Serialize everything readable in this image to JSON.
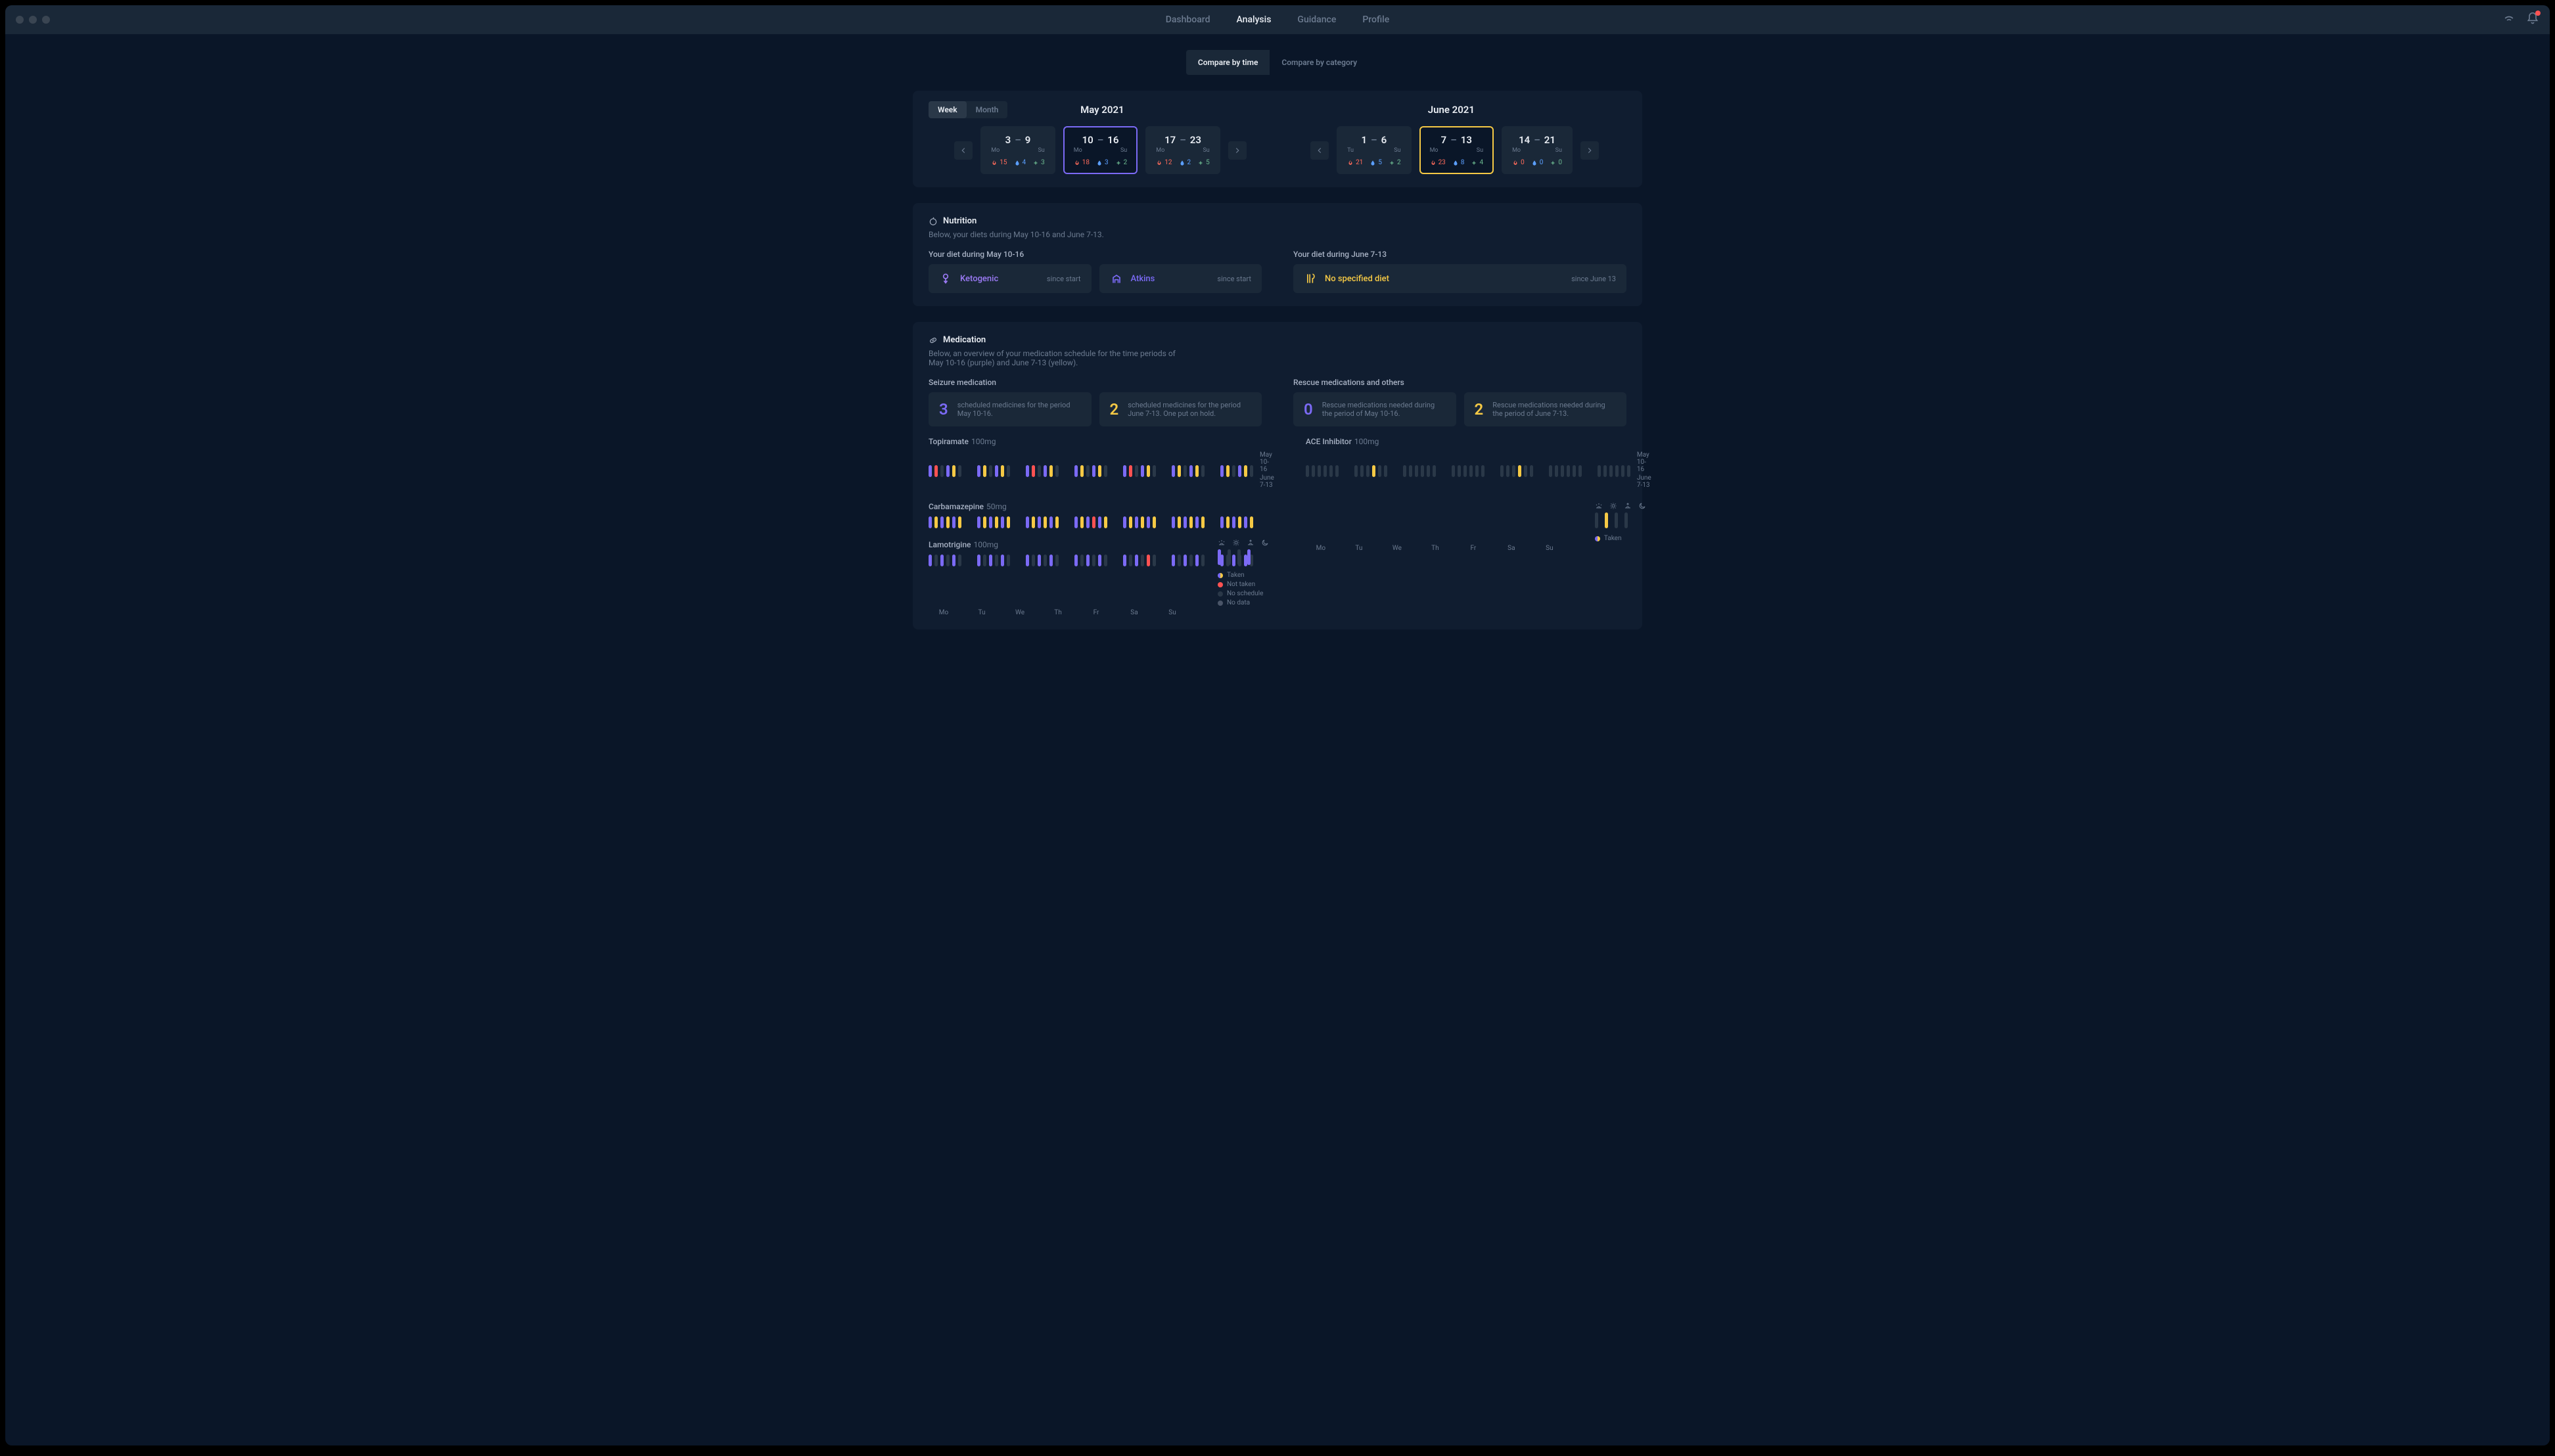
{
  "nav": {
    "tabs": [
      "Dashboard",
      "Analysis",
      "Guidance",
      "Profile"
    ],
    "active_index": 1
  },
  "compare": {
    "by_time": "Compare by time",
    "by_category": "Compare by category",
    "active": "by_time"
  },
  "range_seg": {
    "week": "Week",
    "month": "Month",
    "active": "week"
  },
  "periods": {
    "left": {
      "label": "May 2021",
      "weeks": [
        {
          "d1": "3",
          "d2": "9",
          "day1": "Mo",
          "day2": "Su",
          "fire": 15,
          "drop": 4,
          "med": 3
        },
        {
          "d1": "10",
          "d2": "16",
          "day1": "Mo",
          "day2": "Su",
          "fire": 18,
          "drop": 3,
          "med": 2,
          "selected": "purple"
        },
        {
          "d1": "17",
          "d2": "23",
          "day1": "Mo",
          "day2": "Su",
          "fire": 12,
          "drop": 2,
          "med": 5
        }
      ]
    },
    "right": {
      "label": "June 2021",
      "weeks": [
        {
          "d1": "1",
          "d2": "6",
          "day1": "Tu",
          "day2": "Su",
          "fire": 21,
          "drop": 5,
          "med": 2
        },
        {
          "d1": "7",
          "d2": "13",
          "day1": "Mo",
          "day2": "Su",
          "fire": 23,
          "drop": 8,
          "med": 4,
          "selected": "yellow"
        },
        {
          "d1": "14",
          "d2": "21",
          "day1": "Mo",
          "day2": "Su",
          "fire": 0,
          "drop": 0,
          "med": 0
        }
      ]
    }
  },
  "nutrition": {
    "header": "Nutrition",
    "sub": "Below, your diets during May 10-16 and June 7-13.",
    "left_hdr": "Your diet during May 10-16",
    "right_hdr": "Your diet during June 7-13",
    "diets_left": [
      {
        "name": "Ketogenic",
        "since": "since start",
        "kind": "keto"
      },
      {
        "name": "Atkins",
        "since": "since start",
        "kind": "atkins"
      }
    ],
    "diets_right": [
      {
        "name": "No specified diet",
        "since": "since June 13",
        "kind": "none"
      }
    ]
  },
  "medication": {
    "header": "Medication",
    "sub": "Below, an overview of your medication schedule for the time periods of May 10-16 (purple) and June 7-13 (yellow).",
    "seizure_hdr": "Seizure medication",
    "rescue_hdr": "Rescue medications and others",
    "cards": {
      "seizure": [
        {
          "num": "3",
          "desc": "scheduled medicines for the period May 10-16.",
          "cls": "purple"
        },
        {
          "num": "2",
          "desc": "scheduled medicines for the period June 7-13. One put on hold.",
          "cls": "yellow"
        }
      ],
      "rescue": [
        {
          "num": "0",
          "desc": "Rescue medications needed during the period of May 10-16.",
          "cls": "purple"
        },
        {
          "num": "2",
          "desc": "Rescue medications needed during the period of June 7-13.",
          "cls": "yellow"
        }
      ]
    },
    "seizure_meds": [
      {
        "name": "Topiramate",
        "dose": "100mg",
        "pattern": "mixed_red"
      },
      {
        "name": "Carbamazepine",
        "dose": "50mg",
        "pattern": "full"
      },
      {
        "name": "Lamotrigine",
        "dose": "100mg",
        "pattern": "purple_only"
      }
    ],
    "rescue_meds": [
      {
        "name": "ACE Inhibitor",
        "dose": "100mg",
        "pattern": "rescue"
      }
    ],
    "legend_side_left": {
      "a": "May 10-16",
      "b": "June 7-13"
    },
    "legend_side_right": {
      "a": "May 10-16",
      "b": "June 7-13"
    },
    "legend_main": {
      "taken": "Taken",
      "not_taken": "Not taken",
      "no_schedule": "No schedule",
      "no_data": "No data"
    },
    "legend_right": {
      "taken": "Taken"
    },
    "weekdays": [
      "Mo",
      "Tu",
      "We",
      "Th",
      "Fr",
      "Sa",
      "Su"
    ]
  },
  "icons": {
    "wifi": "wifi-icon",
    "bell": "bell-icon",
    "chev_l": "chevron-left-icon",
    "chev_r": "chevron-right-icon"
  }
}
